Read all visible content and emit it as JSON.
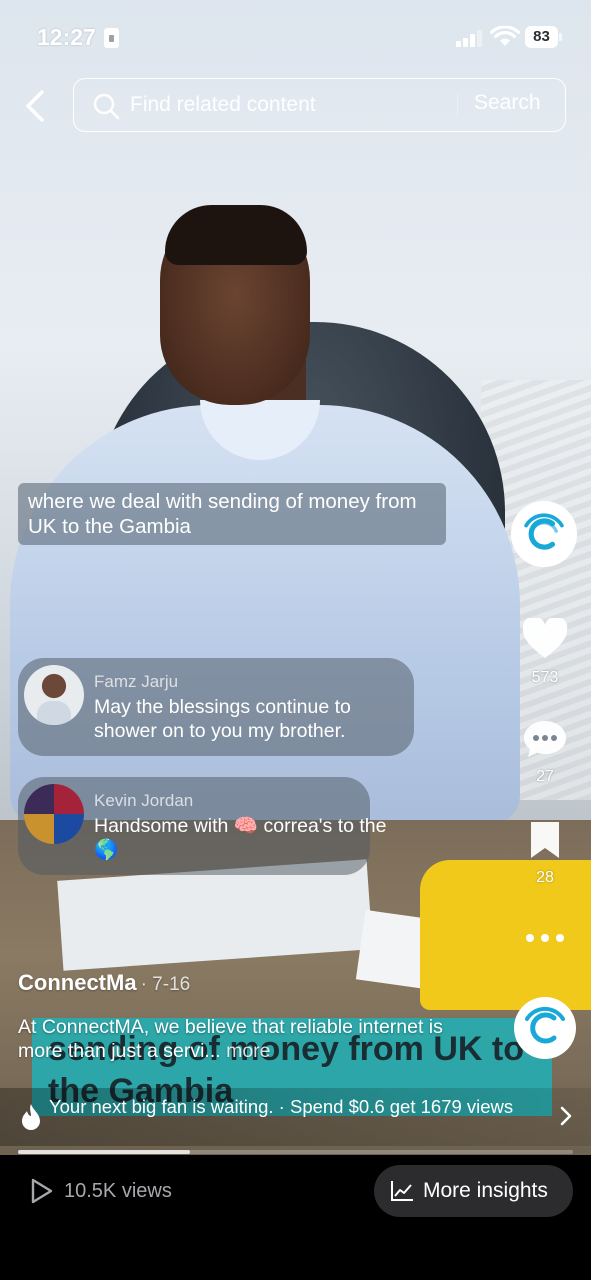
{
  "status_bar": {
    "time": "12:27",
    "battery": "83"
  },
  "search": {
    "placeholder": "Find related content",
    "button_label": "Search"
  },
  "video": {
    "caption": "where we deal with sending of money from UK to the Gambia",
    "banner_text": "sending of money from UK to the Gambia"
  },
  "comments": [
    {
      "user": "Famz Jarju",
      "text": "May the blessings continue to shower on to you my brother."
    },
    {
      "user": "Kevin Jordan",
      "text_before": "Handsome with",
      "emoji_1": "🧠",
      "text_after": "correa's to the",
      "emoji_2": "🌎"
    }
  ],
  "actions": {
    "likes": "573",
    "comments": "27",
    "saves": "28"
  },
  "post": {
    "author": "ConnectMa",
    "date": "· 7-16",
    "description": "At ConnectMA, we believe that reliable internet is more than just a servi...",
    "more_label": "more"
  },
  "promo": {
    "text": "Your next big fan is waiting. · Spend $0.6 get 1679 views"
  },
  "playback": {
    "progress_fraction": 0.31
  },
  "bottom": {
    "views": "10.5K views",
    "insights_label": "More insights"
  },
  "colors": {
    "accent_teal": "#1fb0b6",
    "brand_cyan": "#18a9d8",
    "bottom_bar": "#000000"
  }
}
